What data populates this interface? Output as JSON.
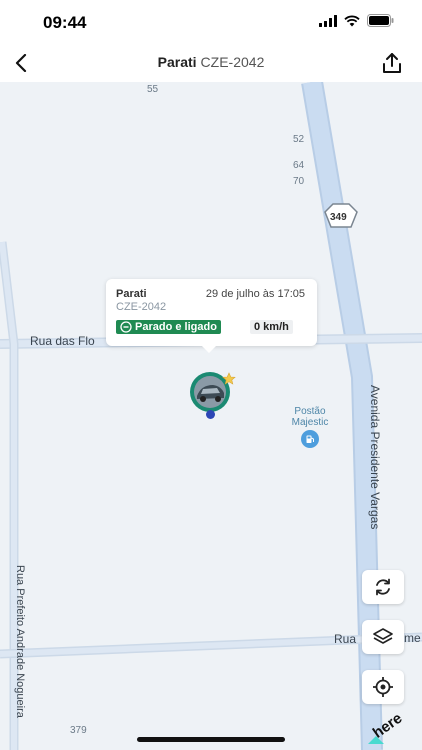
{
  "status_bar": {
    "time": "09:44"
  },
  "nav": {
    "vehicle_name": "Parati",
    "plate": "CZE-2042"
  },
  "map": {
    "labels": {
      "n55": "55",
      "n52": "52",
      "n64": "64",
      "n70": "70",
      "n379": "379"
    },
    "route_shield": "349",
    "streets": {
      "rua_das_flores": "Rua das Flo",
      "avenida": "Avenida Presidente Vargas",
      "rua_prefeito": "Rua Prefeito Andrade Nogueira",
      "rua_bottom": "Rua",
      "rua_bottom_end": "me"
    },
    "poi": {
      "name": "Postão Majestic"
    },
    "attribution": "here"
  },
  "popup": {
    "name": "Parati",
    "date": "29 de julho às 17:05",
    "plate": "CZE-2042",
    "status": "Parado e ligado",
    "speed": "0 km/h"
  },
  "controls": {
    "refresh": "refresh-icon",
    "layers": "layers-icon",
    "locate": "locate-icon"
  },
  "colors": {
    "status_green": "#1f8a52",
    "road": "#c6d8ee",
    "map_bg": "#eef2f6"
  }
}
